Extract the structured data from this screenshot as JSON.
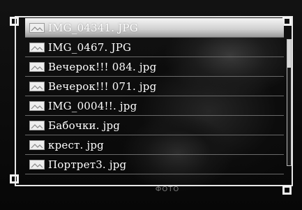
{
  "file_list": {
    "items": [
      {
        "label": "IMG_04341. JPG",
        "icon": "image-file-icon",
        "selected": true
      },
      {
        "label": "IMG_0467. JPG",
        "icon": "image-file-icon",
        "selected": false
      },
      {
        "label": "Вечерок!!! 084. jpg",
        "icon": "image-file-icon",
        "selected": false
      },
      {
        "label": "Вечерок!!! 071. jpg",
        "icon": "image-file-icon",
        "selected": false
      },
      {
        "label": "IMG_0004!!. jpg",
        "icon": "image-file-icon",
        "selected": false
      },
      {
        "label": "Бабочки. jpg",
        "icon": "image-file-icon",
        "selected": false
      },
      {
        "label": "крест. jpg",
        "icon": "image-file-icon",
        "selected": false
      },
      {
        "label": "Портрет3. jpg",
        "icon": "image-file-icon",
        "selected": false
      }
    ]
  },
  "footer": {
    "label": "ФОТО"
  },
  "colors": {
    "frame": "#e8e8e8",
    "selected_row": "#dcdcdc",
    "text": "#ffffff",
    "background": "#0a0a0a"
  }
}
